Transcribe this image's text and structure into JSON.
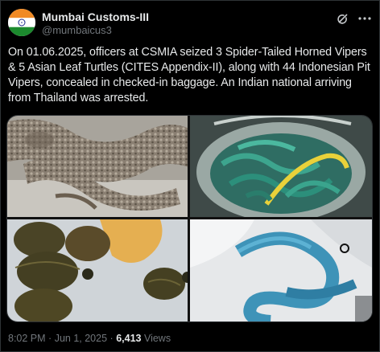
{
  "account": {
    "name": "Mumbai Customs-III",
    "handle": "@mumbaicus3",
    "avatar_icon": "india-flag-icon"
  },
  "header_icons": [
    "grok-icon",
    "more-options-icon"
  ],
  "tweet": {
    "text": "On 01.06.2025, officers at CSMIA seized 3 Spider-Tailed Horned Vipers & 5 Asian Leaf Turtles (CITES Appendix-II), along with 44 Indonesian Pit Vipers, concealed in checked-in baggage. An Indian national arriving from Thailand was arrested."
  },
  "media": [
    {
      "subject": "spider-tailed-horned-viper-photo"
    },
    {
      "subject": "pit-vipers-in-container-photo"
    },
    {
      "subject": "asian-leaf-turtles-photo"
    },
    {
      "subject": "blue-pit-viper-photo"
    }
  ],
  "meta": {
    "time": "8:02 PM",
    "separator1": "·",
    "date": "Jun 1, 2025",
    "separator2": "·",
    "views_count": "6,413",
    "views_label": "Views"
  },
  "colors": {
    "background": "#000000",
    "text": "#e7e9ea",
    "muted": "#71767b",
    "border": "#2f3336"
  }
}
